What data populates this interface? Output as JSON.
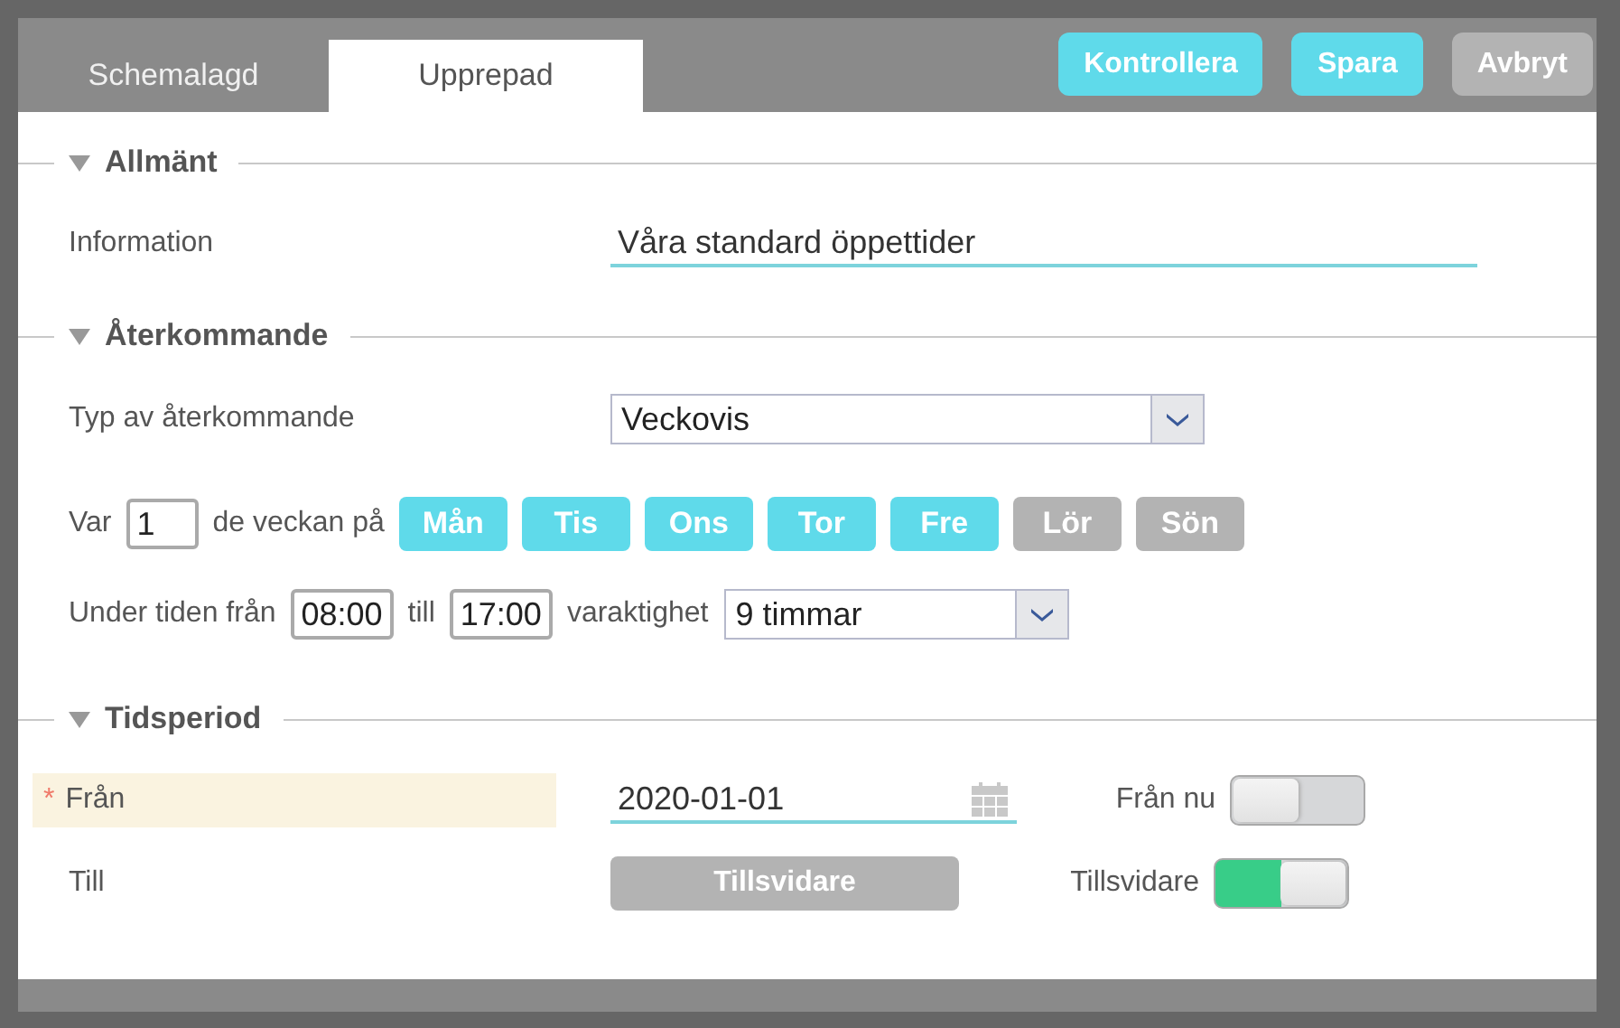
{
  "tabs": [
    {
      "label": "Schemalagd",
      "selected": false
    },
    {
      "label": "Upprepad",
      "selected": true
    }
  ],
  "buttons": [
    {
      "label": "Kontrollera",
      "disabled": false
    },
    {
      "label": "Spara",
      "disabled": false
    },
    {
      "label": "Avbryt",
      "disabled": true
    }
  ],
  "general": {
    "title": "Allmänt",
    "expanded": true,
    "information_label": "Information",
    "information_value": "Våra standard öppettider"
  },
  "recurrence": {
    "title": "Återkommande",
    "expanded": true,
    "type_label": "Typ av återkommande",
    "type_value": "Veckovis",
    "every_label": "Var",
    "every_value": "1",
    "week_label": "de veckan på",
    "days": [
      {
        "label": "Mån",
        "selected": true
      },
      {
        "label": "Tis",
        "selected": true
      },
      {
        "label": "Ons",
        "selected": true
      },
      {
        "label": "Tor",
        "selected": true
      },
      {
        "label": "Fre",
        "selected": true
      },
      {
        "label": "Lör",
        "selected": false
      },
      {
        "label": "Sön",
        "selected": false
      }
    ],
    "time_label": "Under tiden från",
    "time_from": "08:00",
    "till_label": "till",
    "time_to": "17:00",
    "duration_label": "varaktighet",
    "duration_value": "9 timmar"
  },
  "period": {
    "title": "Tidsperiod",
    "expanded": true,
    "from": {
      "label": "Från",
      "required": true,
      "required_marker": "*",
      "value": "2020-01-01",
      "toggle_label": "Från nu",
      "on": false
    },
    "to": {
      "label": "Till",
      "button": "Tillsvidare",
      "toggle_label": "Tillsvidare",
      "on": true
    }
  }
}
